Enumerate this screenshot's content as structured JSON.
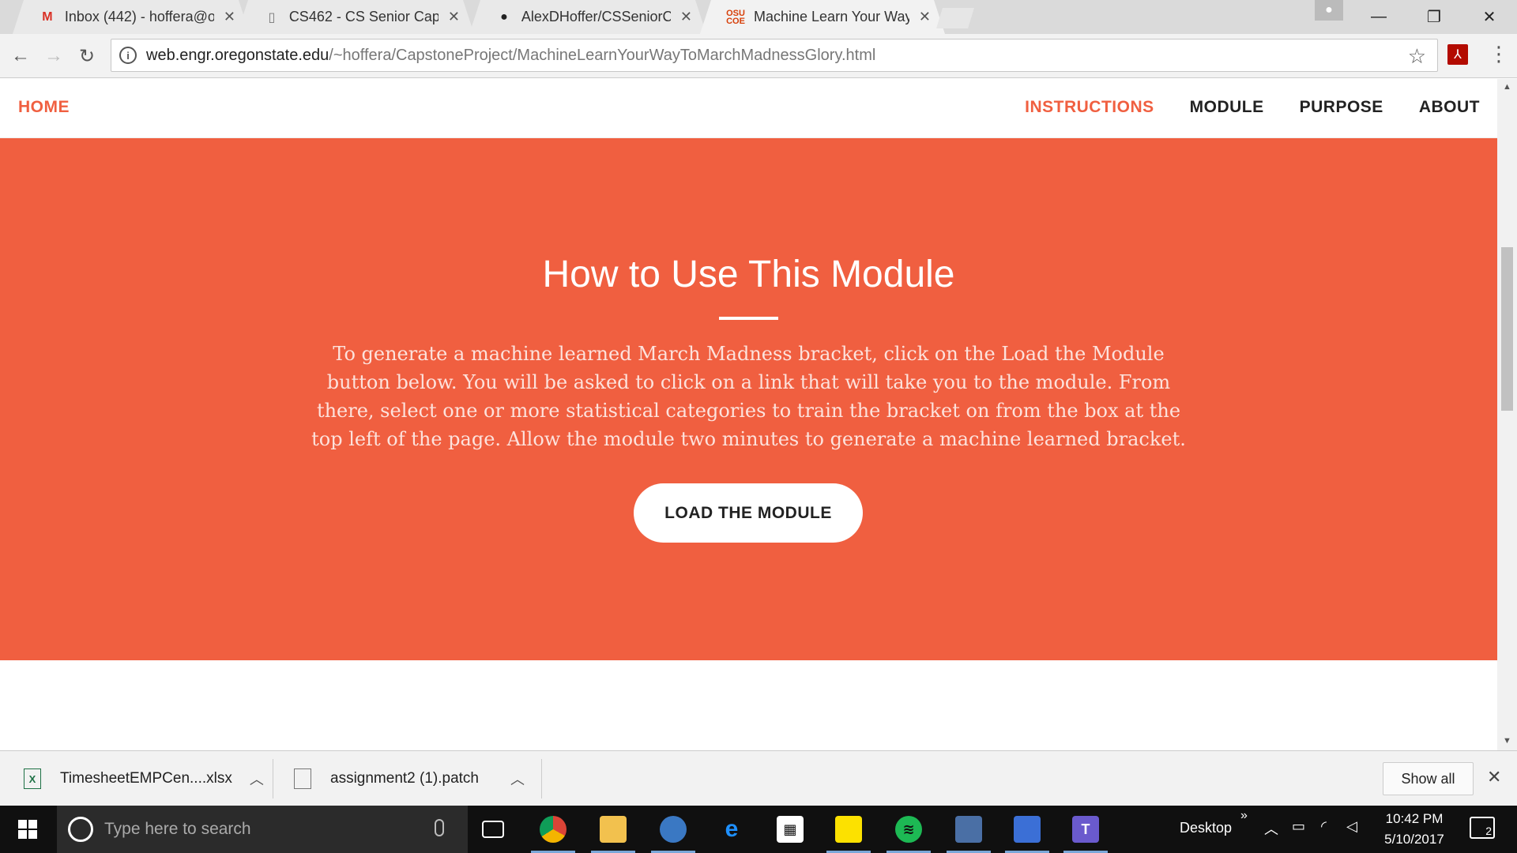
{
  "browser": {
    "tabs": [
      {
        "title": "Inbox (442) - hoffera@or",
        "icon": "gmail-icon",
        "active": false
      },
      {
        "title": "CS462 - CS Senior Capsto",
        "icon": "document-icon",
        "active": false
      },
      {
        "title": "AlexDHoffer/CSSeniorCa",
        "icon": "github-icon",
        "active": false
      },
      {
        "title": "Machine Learn Your Way",
        "icon": "osu-coe-icon",
        "active": true
      }
    ],
    "url_host": "web.engr.oregonstate.edu",
    "url_path": "/~hoffera/CapstoneProject/MachineLearnYourWayToMarchMadnessGlory.html"
  },
  "site": {
    "nav_home": "HOME",
    "nav_links": [
      "INSTRUCTIONS",
      "MODULE",
      "PURPOSE",
      "ABOUT"
    ],
    "active_link": "INSTRUCTIONS",
    "accent_color": "#f05f40",
    "hero_title": "How to Use This Module",
    "hero_text": "To generate a machine learned March Madness bracket, click on the Load the Module button below. You will be asked to click on a link that will take you to the module. From there, select one or more statistical categories to train the bracket on from the box at the top left of the page. Allow the module two minutes to generate a machine learned bracket.",
    "hero_button": "LOAD THE MODULE"
  },
  "downloads": {
    "items": [
      {
        "name": "TimesheetEMPCen....xlsx",
        "icon": "excel-icon"
      },
      {
        "name": "assignment2 (1).patch",
        "icon": "file-icon"
      }
    ],
    "show_all": "Show all"
  },
  "taskbar": {
    "search_placeholder": "Type here to search",
    "desktop_label": "Desktop",
    "time": "10:42 PM",
    "date": "5/10/2017",
    "notification_count": "2"
  }
}
